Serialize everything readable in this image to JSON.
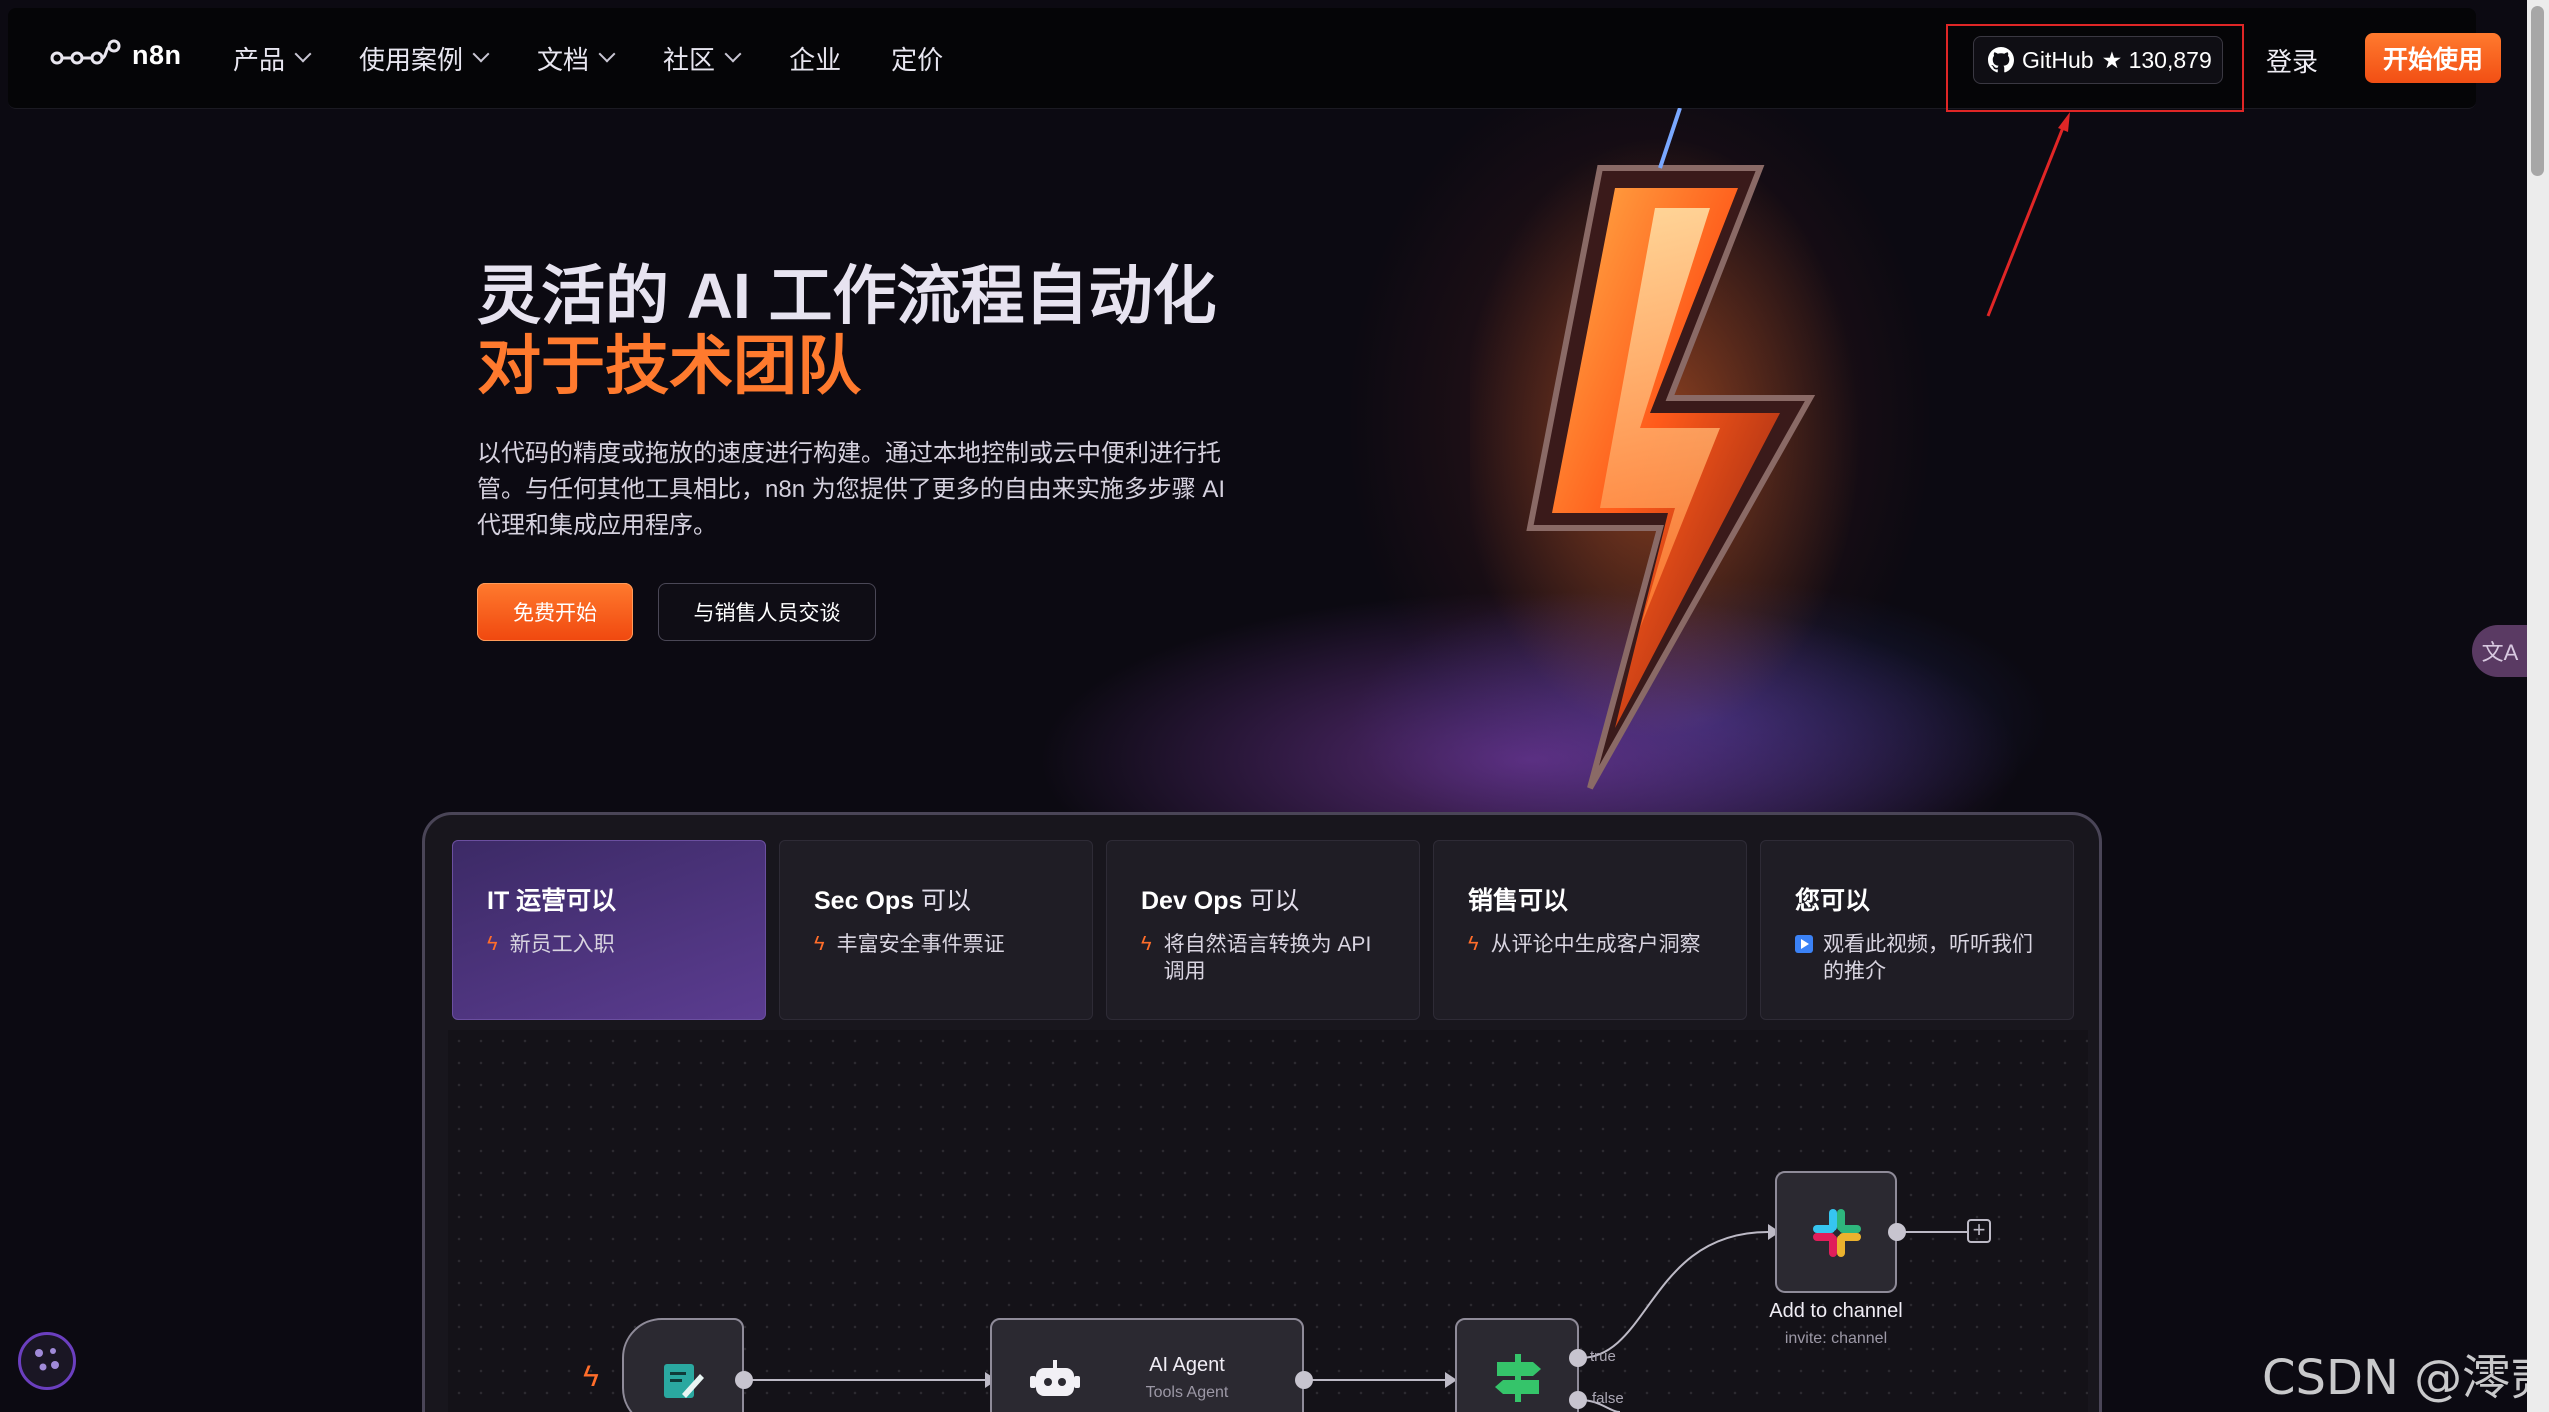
{
  "nav": {
    "logo_text": "n8n",
    "links": [
      {
        "label": "产品",
        "dropdown": true
      },
      {
        "label": "使用案例",
        "dropdown": true
      },
      {
        "label": "文档",
        "dropdown": true
      },
      {
        "label": "社区",
        "dropdown": true
      },
      {
        "label": "企业",
        "dropdown": false
      },
      {
        "label": "定价",
        "dropdown": false
      }
    ],
    "github_label": "GitHub",
    "github_stars": "★ 130,879",
    "login": "登录",
    "start": "开始使用"
  },
  "hero": {
    "title": "灵活的 AI 工作流程自动化",
    "subtitle": "对于技术团队",
    "description": "以代码的精度或拖放的速度进行构建。通过本地控制或云中便利进行托管。与任何其他工具相比，n8n 为您提供了更多的自由来实施多步骤 AI 代理和集成应用程序。",
    "btn_free": "免费开始",
    "btn_sales": "与销售人员交谈"
  },
  "tabs": [
    {
      "title_bold": "IT 运营可以",
      "title_light": "",
      "item": "新员工入职",
      "icon": "bolt-icon",
      "active": true
    },
    {
      "title_bold": "Sec Ops",
      "title_light": " 可以",
      "item": "丰富安全事件票证",
      "icon": "bolt-icon",
      "active": false
    },
    {
      "title_bold": "Dev Ops",
      "title_light": " 可以",
      "item": "将自然语言转换为 API 调用",
      "icon": "bolt-icon",
      "active": false
    },
    {
      "title_bold": "销售可以",
      "title_light": "",
      "item": "从评论中生成客户洞察",
      "icon": "bolt-icon",
      "active": false
    },
    {
      "title_bold": "您可以",
      "title_light": "",
      "item": "观看此视频，听听我们的推介",
      "icon": "video-icon",
      "active": false
    }
  ],
  "workflow": {
    "agent_title": "AI Agent",
    "agent_sub": "Tools Agent",
    "slack_title": "Add to channel",
    "slack_sub": "invite: channel",
    "branch_true": "true",
    "branch_false": "false"
  },
  "translate_label": "文A",
  "watermark": "CSDN @澪贰",
  "colors": {
    "accent": "#ff6d2a",
    "highlight_box": "#e02626",
    "active_tab": "#5b3c90"
  }
}
